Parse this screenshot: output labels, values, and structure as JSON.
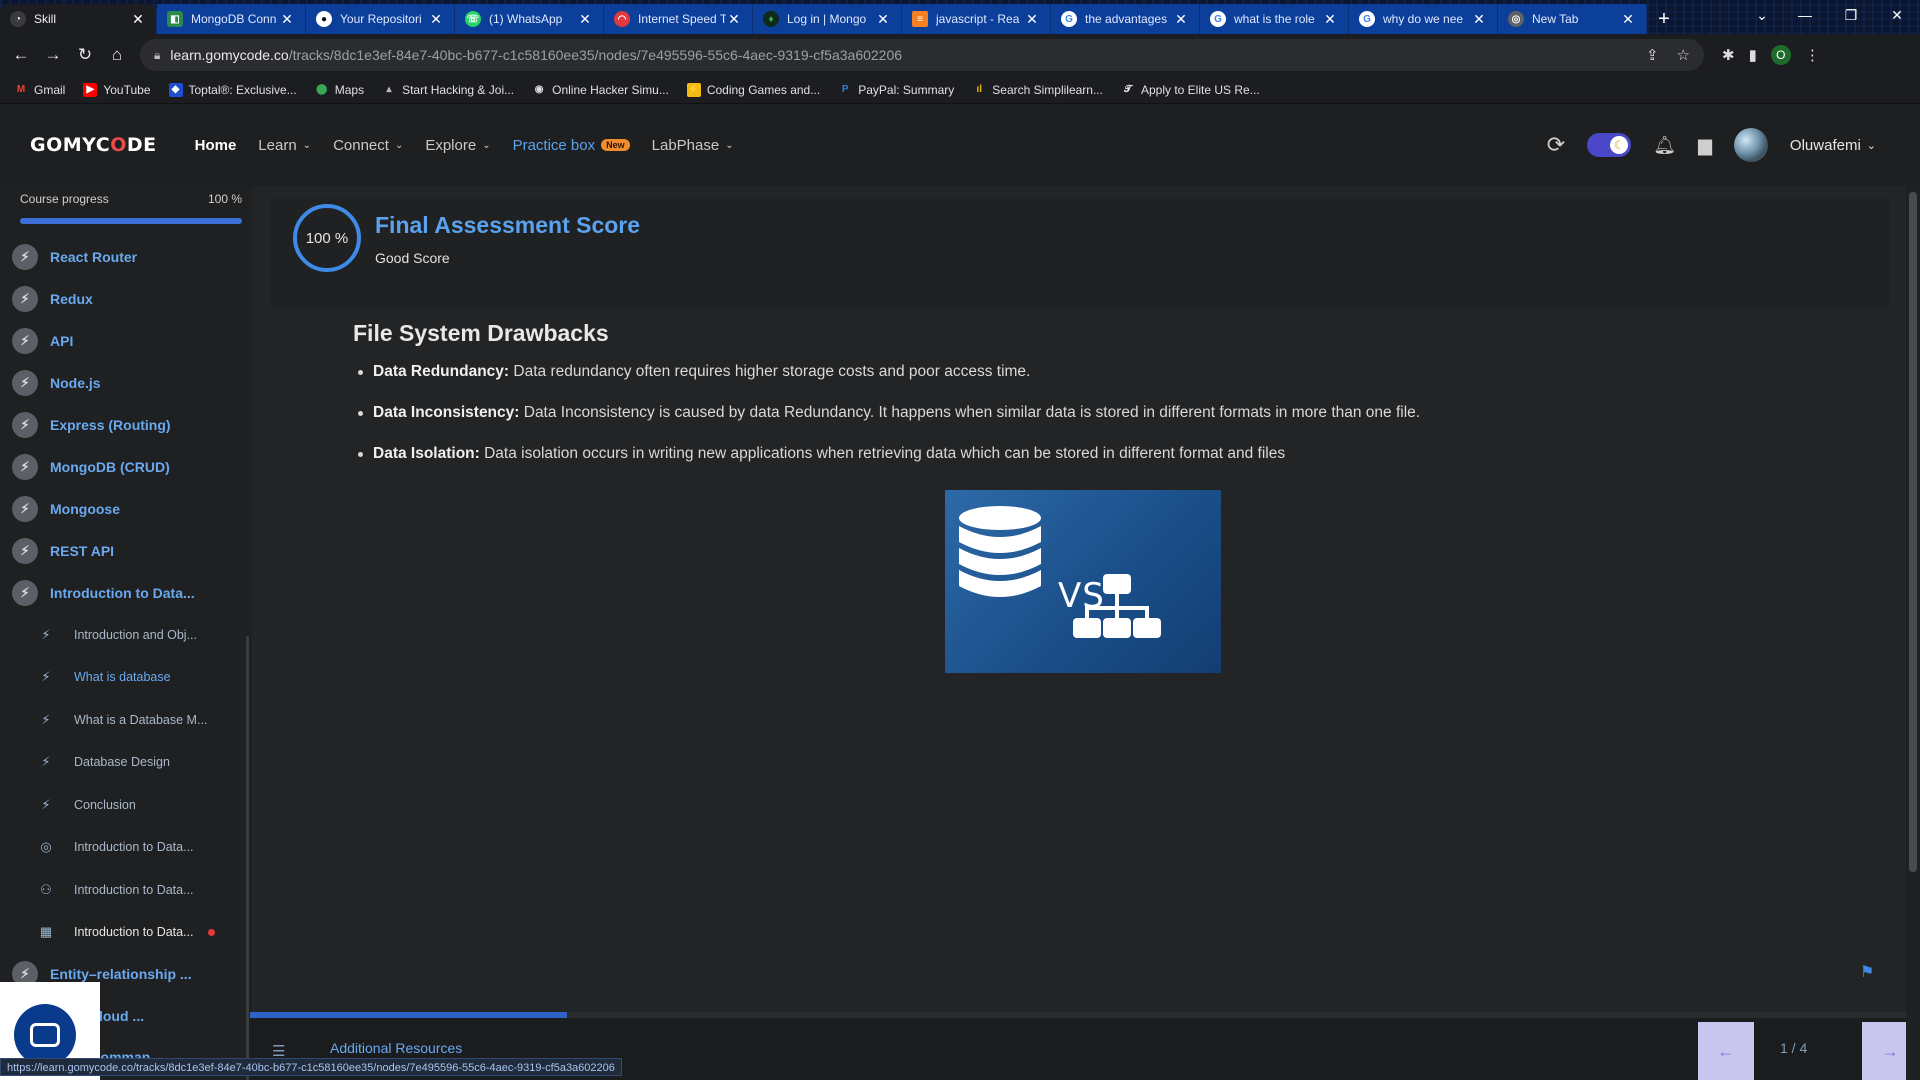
{
  "browser": {
    "tabs": [
      {
        "label": "Skill",
        "icon": "skill-favicon",
        "active": true
      },
      {
        "label": "MongoDB Conn",
        "icon": "mongodb-favicon"
      },
      {
        "label": "Your Repositori",
        "icon": "github-favicon"
      },
      {
        "label": "(1) WhatsApp",
        "icon": "whatsapp-favicon"
      },
      {
        "label": "Internet Speed T",
        "icon": "speedtest-favicon"
      },
      {
        "label": "Log in | Mongo",
        "icon": "mongodb-leaf-favicon"
      },
      {
        "label": "javascript - Rea",
        "icon": "stackoverflow-favicon"
      },
      {
        "label": "the advantages",
        "icon": "google-favicon"
      },
      {
        "label": "what is the role",
        "icon": "google-favicon"
      },
      {
        "label": "why do we nee",
        "icon": "google-favicon"
      },
      {
        "label": "New Tab",
        "icon": "chrome-favicon"
      }
    ],
    "url": {
      "host": "learn.gomycode.co",
      "path": "/tracks/8dc1e3ef-84e7-40bc-b677-c1c58160ee35/nodes/7e495596-55c6-4aec-9319-cf5a3a602206"
    },
    "profile_initial": "O",
    "bookmarks": [
      {
        "label": "Gmail",
        "icon": "gmail-icon"
      },
      {
        "label": "YouTube",
        "icon": "youtube-icon"
      },
      {
        "label": "Toptal®: Exclusive...",
        "icon": "toptal-icon"
      },
      {
        "label": "Maps",
        "icon": "maps-icon"
      },
      {
        "label": "Start Hacking & Joi...",
        "icon": "hacking-icon"
      },
      {
        "label": "Online Hacker Simu...",
        "icon": "hacker-sim-icon"
      },
      {
        "label": "Coding Games and...",
        "icon": "codingame-icon"
      },
      {
        "label": "PayPal: Summary",
        "icon": "paypal-icon"
      },
      {
        "label": "Search Simplilearn...",
        "icon": "simplilearn-icon"
      },
      {
        "label": "Apply to Elite US Re...",
        "icon": "apply-icon"
      }
    ],
    "status_url": "https://learn.gomycode.co/tracks/8dc1e3ef-84e7-40bc-b677-c1c58160ee35/nodes/7e495596-55c6-4aec-9319-cf5a3a602206"
  },
  "header": {
    "logo": {
      "part1": "GOMYC",
      "part2": "O",
      "part3": "DE"
    },
    "nav": [
      {
        "label": "Home",
        "dropdown": false
      },
      {
        "label": "Learn",
        "dropdown": true
      },
      {
        "label": "Connect",
        "dropdown": true
      },
      {
        "label": "Explore",
        "dropdown": true
      },
      {
        "label": "Practice box",
        "dropdown": false,
        "badge": "New"
      },
      {
        "label": "LabPhase",
        "dropdown": true
      }
    ],
    "username": "Oluwafemi"
  },
  "sidebar": {
    "progress_label": "Course progress",
    "progress_value": "100 %",
    "progress_fraction": 1.0,
    "modules": [
      "React Router",
      "Redux",
      "API",
      "Node.js",
      "Express (Routing)",
      "MongoDB (CRUD)",
      "Mongoose",
      "REST API",
      "Introduction to Data..."
    ],
    "subitems": [
      {
        "label": "Introduction and Obj...",
        "icon": "bolt-icon"
      },
      {
        "label": "What is database",
        "icon": "bolt-icon",
        "state": "active"
      },
      {
        "label": "What is a Database M...",
        "icon": "bolt-icon"
      },
      {
        "label": "Database Design",
        "icon": "bolt-icon"
      },
      {
        "label": "Conclusion",
        "icon": "bolt-icon"
      },
      {
        "label": "Introduction to Data...",
        "icon": "target-icon"
      },
      {
        "label": "Introduction to Data...",
        "icon": "people-icon"
      },
      {
        "label": "Introduction to Data...",
        "icon": "board-icon",
        "state": "current"
      }
    ],
    "modules_after": [
      "Entity–relationship ...",
      "ion & Cloud ...",
      "Flow (Comman..."
    ]
  },
  "content": {
    "score_value": "100 %",
    "score_title": "Final Assessment Score",
    "score_sub": "Good Score",
    "heading": "File System Drawbacks",
    "bullets": [
      {
        "term": "Data Redundancy:",
        "text": " Data redundancy often requires higher storage costs and poor access time."
      },
      {
        "term": "Data Inconsistency:",
        "text": " Data Inconsistency is caused by data Redundancy. It happens when similar data is stored in different formats in more than one file."
      },
      {
        "term": "Data Isolation:",
        "text": " Data isolation occurs in writing new applications when retrieving data which can be stored in different format and files"
      }
    ],
    "image_text": "VS"
  },
  "footer": {
    "additional_resources": "Additional Resources",
    "page_indicator": "1 / 4",
    "progress_fraction": 0.19
  },
  "colors": {
    "accent": "#5aa2ee",
    "progress": "#3d6fd6",
    "badge": "#f28c2e",
    "pager": "#c8c5ef"
  }
}
